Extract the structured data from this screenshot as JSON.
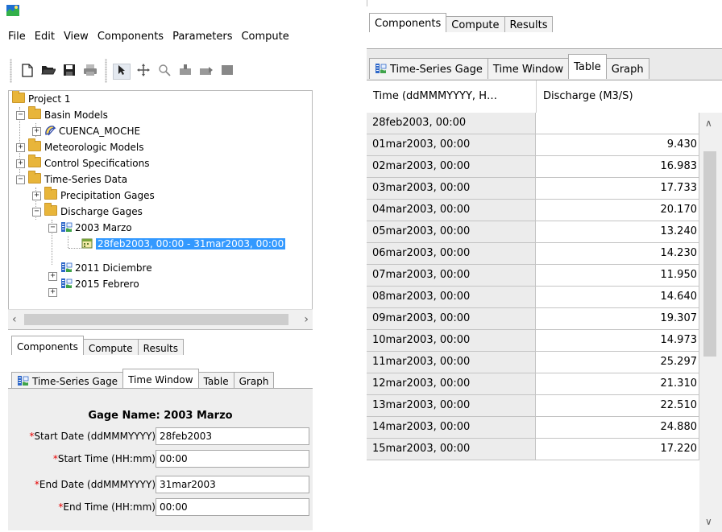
{
  "left_window": {
    "menu": [
      "File",
      "Edit",
      "View",
      "Components",
      "Parameters",
      "Compute"
    ],
    "tree": {
      "project": "Project 1",
      "basin_models": "Basin Models",
      "basin": "CUENCA_MOCHE",
      "meteorologic": "Meteorologic Models",
      "control": "Control Specifications",
      "ts_data": "Time-Series Data",
      "precip": "Precipitation Gages",
      "discharge": "Discharge Gages",
      "gage1": "2003 Marzo",
      "window1": "28feb2003, 00:00 - 31mar2003, 00:00",
      "gage2": "2011 Diciembre",
      "gage3": "2015 Febrero"
    },
    "tabs": [
      "Components",
      "Compute",
      "Results"
    ],
    "sub_tabs": [
      "Time-Series Gage",
      "Time Window",
      "Table",
      "Graph"
    ],
    "gage_name": "Gage Name: 2003 Marzo",
    "form": {
      "start_date_label": "Start Date (ddMMMYYYY)",
      "start_date": "28feb2003",
      "start_time_label": "Start Time (HH:mm)",
      "start_time": "00:00",
      "end_date_label": "End Date (ddMMMYYYY)",
      "end_date": "31mar2003",
      "end_time_label": "End Time (HH:mm)",
      "end_time": "00:00",
      "required_mark": "*"
    }
  },
  "right_window": {
    "tabs": [
      "Components",
      "Compute",
      "Results"
    ],
    "sub_tabs": [
      "Time-Series Gage",
      "Time Window",
      "Table",
      "Graph"
    ],
    "table": {
      "headers": [
        "Time (ddMMMYYYY, H…",
        "Discharge (M3/S)"
      ],
      "rows": [
        [
          "28feb2003, 00:00",
          ""
        ],
        [
          "01mar2003, 00:00",
          "9.430"
        ],
        [
          "02mar2003, 00:00",
          "16.983"
        ],
        [
          "03mar2003, 00:00",
          "17.733"
        ],
        [
          "04mar2003, 00:00",
          "20.170"
        ],
        [
          "05mar2003, 00:00",
          "13.240"
        ],
        [
          "06mar2003, 00:00",
          "14.230"
        ],
        [
          "07mar2003, 00:00",
          "11.950"
        ],
        [
          "08mar2003, 00:00",
          "14.640"
        ],
        [
          "09mar2003, 00:00",
          "19.307"
        ],
        [
          "10mar2003, 00:00",
          "14.973"
        ],
        [
          "11mar2003, 00:00",
          "25.297"
        ],
        [
          "12mar2003, 00:00",
          "21.310"
        ],
        [
          "13mar2003, 00:00",
          "22.510"
        ],
        [
          "14mar2003, 00:00",
          "24.880"
        ],
        [
          "15mar2003, 00:00",
          "17.220"
        ]
      ]
    }
  },
  "icons": {
    "app": "hec-hms-app-icon",
    "toolbar": [
      "new-file-icon",
      "open-folder-icon",
      "save-icon",
      "print-icon",
      "select-arrow-icon",
      "pan-icon",
      "zoom-icon",
      "add-element-icon",
      "add-element-icon",
      "grid-icon"
    ],
    "tree": [
      "folder-icon",
      "basin-icon",
      "gage-icon",
      "time-window-icon"
    ]
  },
  "colors": {
    "selection": "#3399ff",
    "folder": "#e8b53a",
    "required": "#e60000",
    "panel_bg": "#eeeeee",
    "first_col_bg": "#ececec"
  }
}
